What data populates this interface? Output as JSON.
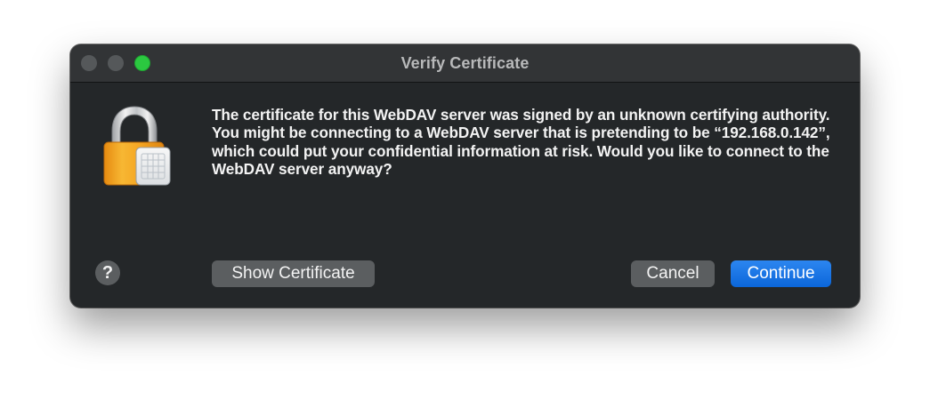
{
  "window": {
    "title": "Verify Certificate"
  },
  "dialog": {
    "message": "The certificate for this WebDAV server was signed by an unknown certifying authority. You might be connecting to a WebDAV server that is pretending to be “192.168.0.142”, which could put your confidential information at risk. Would you like to connect to the WebDAV server anyway?",
    "icon": "lock-certificate-icon"
  },
  "buttons": {
    "help_label": "?",
    "show_certificate_label": "Show Certificate",
    "cancel_label": "Cancel",
    "continue_label": "Continue"
  },
  "colors": {
    "window_bg": "#242729",
    "titlebar_bg": "#323436",
    "secondary_button": "#5b5e60",
    "primary_button": "#1a73e8",
    "zoom_light": "#2bc840"
  }
}
